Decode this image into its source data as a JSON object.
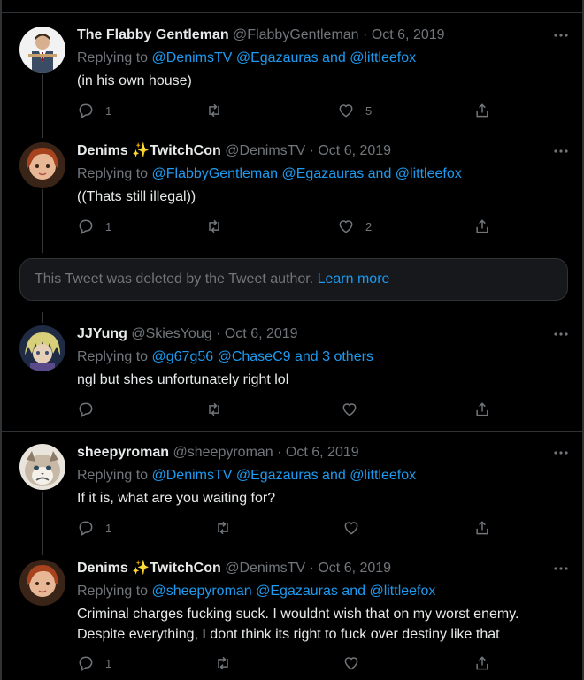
{
  "tweets": [
    {
      "display_name": "The Flabby Gentleman",
      "handle": "@FlabbyGentleman",
      "date": "Oct 6, 2019",
      "replying_prefix": "Replying to",
      "replying_to": "@DenimsTV @Egazauras and @littleefox",
      "text": [
        "(in his own house)"
      ],
      "replies": "1",
      "retweets": "",
      "likes": "5"
    },
    {
      "display_name": "Denims ✨TwitchCon",
      "handle": "@DenimsTV",
      "date": "Oct 6, 2019",
      "replying_prefix": "Replying to",
      "replying_to": "@FlabbyGentleman @Egazauras and @littleefox",
      "text": [
        "((Thats still illegal))"
      ],
      "replies": "1",
      "retweets": "",
      "likes": "2"
    },
    {
      "display_name": "JJYung",
      "handle": "@SkiesYoug",
      "date": "Oct 6, 2019",
      "replying_prefix": "Replying to",
      "replying_to": "@g67g56 @ChaseC9 and 3 others",
      "text": [
        "ngl but shes unfortunately right lol"
      ],
      "replies": "",
      "retweets": "",
      "likes": ""
    },
    {
      "display_name": "sheepyroman",
      "handle": "@sheepyroman",
      "date": "Oct 6, 2019",
      "replying_prefix": "Replying to",
      "replying_to": "@DenimsTV @Egazauras and @littleefox",
      "text": [
        "If it is, what are you waiting for?"
      ],
      "replies": "1",
      "retweets": "",
      "likes": ""
    },
    {
      "display_name": "Denims ✨TwitchCon",
      "handle": "@DenimsTV",
      "date": "Oct 6, 2019",
      "replying_prefix": "Replying to",
      "replying_to": "@sheepyroman @Egazauras and @littleefox",
      "text": [
        "Criminal charges fucking suck. I wouldnt wish that on my worst enemy.",
        "Despite everything, I dont think its right to fuck over destiny like that"
      ],
      "replies": "1",
      "retweets": "",
      "likes": ""
    }
  ],
  "deleted_notice": {
    "text": "This Tweet was deleted by the Tweet author.",
    "link": "Learn more"
  },
  "icons": [
    "reply-icon",
    "retweet-icon",
    "like-icon",
    "share-icon",
    "more-icon"
  ],
  "colors": {
    "background": "#000000",
    "link": "#1d9bf0",
    "muted": "#71767b",
    "text": "#e7e9ea"
  }
}
